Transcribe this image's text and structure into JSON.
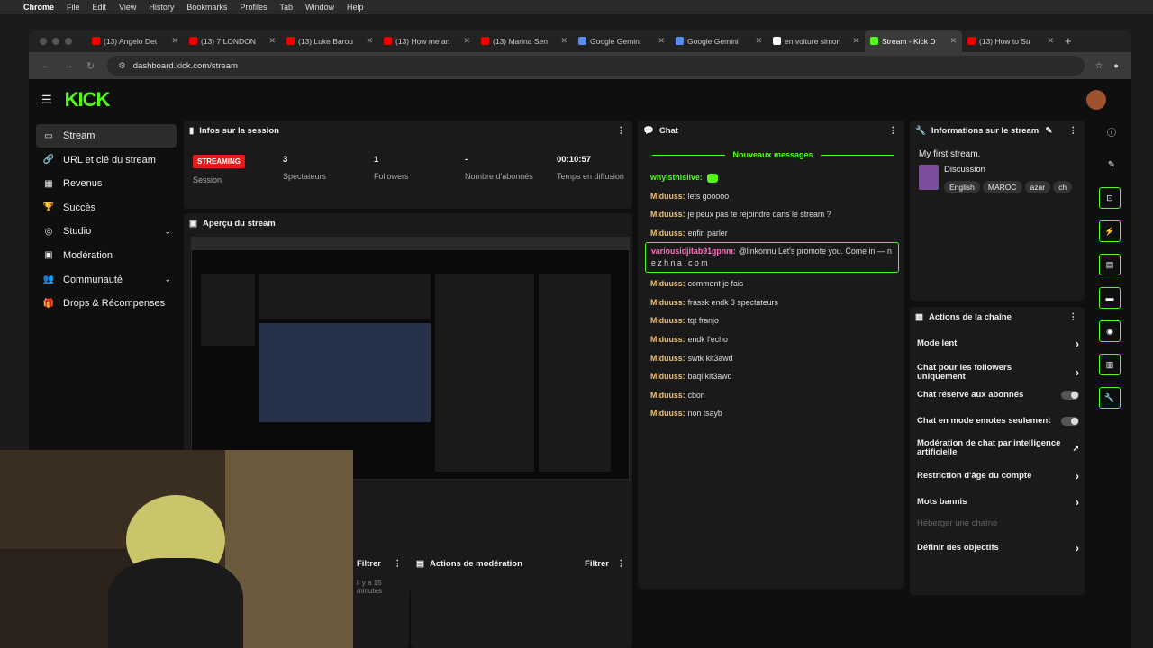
{
  "macmenu": [
    "Chrome",
    "File",
    "Edit",
    "View",
    "History",
    "Bookmarks",
    "Profiles",
    "Tab",
    "Window",
    "Help"
  ],
  "tabs": [
    {
      "title": "(13) Angelo Det",
      "color": "#e00"
    },
    {
      "title": "(13) 7 LONDON",
      "color": "#e00"
    },
    {
      "title": "(13) Luke Barou",
      "color": "#e00"
    },
    {
      "title": "(13) How me an",
      "color": "#e00"
    },
    {
      "title": "(13) Marina Sen",
      "color": "#e00"
    },
    {
      "title": "Google Gemini",
      "color": "#5b8def"
    },
    {
      "title": "Google Gemini",
      "color": "#5b8def"
    },
    {
      "title": "en voiture simon",
      "color": "#fff"
    },
    {
      "title": "Stream - Kick D",
      "color": "#53fc18",
      "active": true
    },
    {
      "title": "(13) How to Str",
      "color": "#e00"
    }
  ],
  "url": "dashboard.kick.com/stream",
  "logo": "KICK",
  "sidebar": [
    {
      "label": "Stream",
      "icon": "▭",
      "active": true
    },
    {
      "label": "URL et clé du stream",
      "icon": "🔗"
    },
    {
      "label": "Revenus",
      "icon": "▦"
    },
    {
      "label": "Succès",
      "icon": "🏆"
    },
    {
      "label": "Studio",
      "icon": "◎",
      "chevron": true
    },
    {
      "label": "Modération",
      "icon": "▣"
    },
    {
      "label": "Communauté",
      "icon": "👥",
      "chevron": true
    },
    {
      "label": "Drops & Récompenses",
      "icon": "🎁"
    }
  ],
  "session": {
    "title": "Infos sur la session",
    "badge": "STREAMING",
    "session_label": "Session",
    "stats": [
      {
        "value": "3",
        "label": "Spectateurs"
      },
      {
        "value": "1",
        "label": "Followers"
      },
      {
        "value": "-",
        "label": "Nombre d'abonnés"
      },
      {
        "value": "00:10:57",
        "label": "Temps en diffusion"
      }
    ]
  },
  "preview": {
    "title": "Aperçu du stream"
  },
  "chat": {
    "title": "Chat",
    "new_messages": "Nouveaux messages",
    "messages": [
      {
        "user": "whyisthislive:",
        "text": "",
        "style": "g"
      },
      {
        "user": "Miduuss:",
        "text": "lets gooooo"
      },
      {
        "user": "Miduuss:",
        "text": "je peux pas te rejoindre dans le stream ?"
      },
      {
        "user": "Miduuss:",
        "text": "enfin parler"
      },
      {
        "user": "Miduuss:",
        "text": "comment je fais"
      },
      {
        "user": "Miduuss:",
        "text": "frassk endk 3 spectateurs"
      },
      {
        "user": "Miduuss:",
        "text": "tqt franjo"
      },
      {
        "user": "Miduuss:",
        "text": "endk l'echo"
      },
      {
        "user": "Miduuss:",
        "text": "swtk kit3awd"
      },
      {
        "user": "Miduuss:",
        "text": "baqi kit3awd"
      },
      {
        "user": "Miduuss:",
        "text": "cbon"
      },
      {
        "user": "Miduuss:",
        "text": "non tsayb"
      }
    ],
    "highlight": {
      "user": "variousidjitab91gpnm:",
      "text": "@linkonnu Let's  promote you. Come in — n e z h n a . c o m"
    }
  },
  "info": {
    "title": "Informations sur le stream",
    "stream_title": "My first stream.",
    "category": "Discussion",
    "tags": [
      "English",
      "MAROC",
      "azar",
      "ch"
    ]
  },
  "actions": {
    "title": "Actions de la chaîne",
    "items": [
      {
        "label": "Mode lent",
        "type": "chevron"
      },
      {
        "label": "Chat pour les followers uniquement",
        "type": "chevron"
      },
      {
        "label": "Chat réservé aux abonnés",
        "type": "toggle"
      },
      {
        "label": "Chat en mode emotes seulement",
        "type": "toggle"
      },
      {
        "label": "Modération de chat par intelligence artificielle",
        "type": "external"
      },
      {
        "label": "Restriction d'âge du compte",
        "type": "chevron"
      },
      {
        "label": "Mots bannis",
        "type": "chevron"
      },
      {
        "label": "Héberger une chaîne",
        "type": "disabled"
      },
      {
        "label": "Définir des objectifs",
        "type": "chevron"
      }
    ]
  },
  "moderation": {
    "title": "Actions de modération",
    "filter": "Filtrer",
    "filter2": "Filtrer",
    "time_ago": "il y a 15 minutes"
  }
}
